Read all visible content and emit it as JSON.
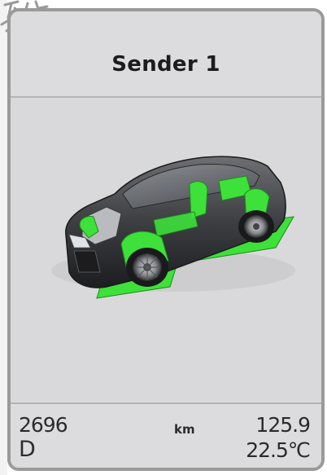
{
  "header": {
    "title": "Sender 1"
  },
  "vehicle": {
    "image_icon": "car-xray-icon",
    "highlight_color": "#3ee03a"
  },
  "footer": {
    "odometer": "2696",
    "gear": "D",
    "unit": "km",
    "distance": "125.9",
    "temperature": "22.5℃"
  },
  "colors": {
    "panel_background": "#d9d9db",
    "panel_border": "#9a9a9a",
    "text": "#1c1c1c",
    "accent_green": "#3ee03a"
  }
}
